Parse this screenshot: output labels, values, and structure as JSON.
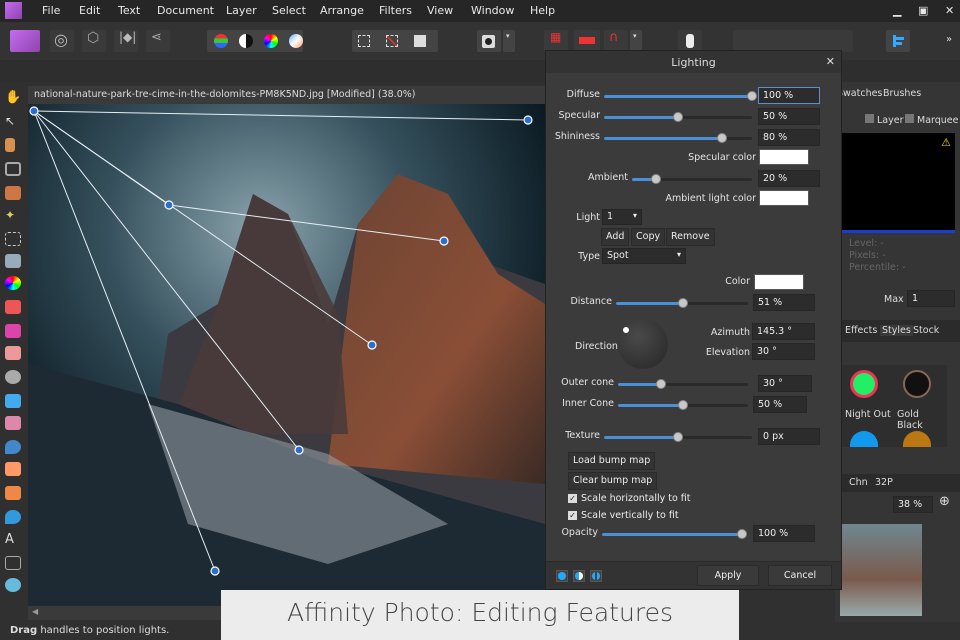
{
  "menu": [
    "File",
    "Edit",
    "Text",
    "Document",
    "Layer",
    "Select",
    "Arrange",
    "Filters",
    "View",
    "Window",
    "Help"
  ],
  "document": {
    "title": "national-nature-park-tre-cime-in-the-dolomites-PM8K5ND.jpg [Modified] (38.0%)"
  },
  "dialog": {
    "title": "Lighting",
    "diffuse": {
      "label": "Diffuse",
      "value": "100 %",
      "fraction": 1.0
    },
    "specular": {
      "label": "Specular",
      "value": "50 %",
      "fraction": 0.5
    },
    "shininess": {
      "label": "Shininess",
      "value": "80 %",
      "fraction": 0.8
    },
    "specular_color_label": "Specular color",
    "ambient": {
      "label": "Ambient",
      "value": "20 %",
      "fraction": 0.2
    },
    "ambient_color_label": "Ambient light color",
    "light_label": "Light",
    "light_value": "1",
    "add": "Add",
    "copy": "Copy",
    "remove": "Remove",
    "type_label": "Type",
    "type_value": "Spot",
    "color_label": "Color",
    "distance": {
      "label": "Distance",
      "value": "51 %",
      "fraction": 0.51
    },
    "direction_label": "Direction",
    "azimuth_label": "Azimuth",
    "azimuth_value": "145.3 °",
    "elevation_label": "Elevation",
    "elevation_value": "30 °",
    "outer_cone": {
      "label": "Outer cone",
      "value": "30 °",
      "fraction": 0.33
    },
    "inner_cone": {
      "label": "Inner Cone",
      "value": "50 %",
      "fraction": 0.5
    },
    "texture": {
      "label": "Texture",
      "value": "0 px",
      "fraction": 0.5
    },
    "load_bump": "Load bump map",
    "clear_bump": "Clear bump map",
    "scale_h": "Scale horizontally to fit",
    "scale_v": "Scale vertically to fit",
    "opacity": {
      "label": "Opacity",
      "value": "100 %",
      "fraction": 1.0
    },
    "apply": "Apply",
    "cancel": "Cancel"
  },
  "right": {
    "tabs1": [
      "Swatches",
      "Brushes"
    ],
    "layer": "Layer",
    "marquee": "Marquee",
    "level": "Level: -",
    "pixels": "Pixels: -",
    "percentile": "Percentile: -",
    "max_label": "Max",
    "max_value": "1",
    "tabs2": [
      "Effects",
      "Styles",
      "Stock"
    ],
    "styles": [
      "Night Out",
      "Gold Black"
    ],
    "tabs3": [
      "Chn",
      "32P"
    ],
    "zoom": "38 %"
  },
  "status": {
    "bold": "Drag",
    "text": " handles to position lights."
  },
  "caption": "Affinity Photo: Editing Features"
}
